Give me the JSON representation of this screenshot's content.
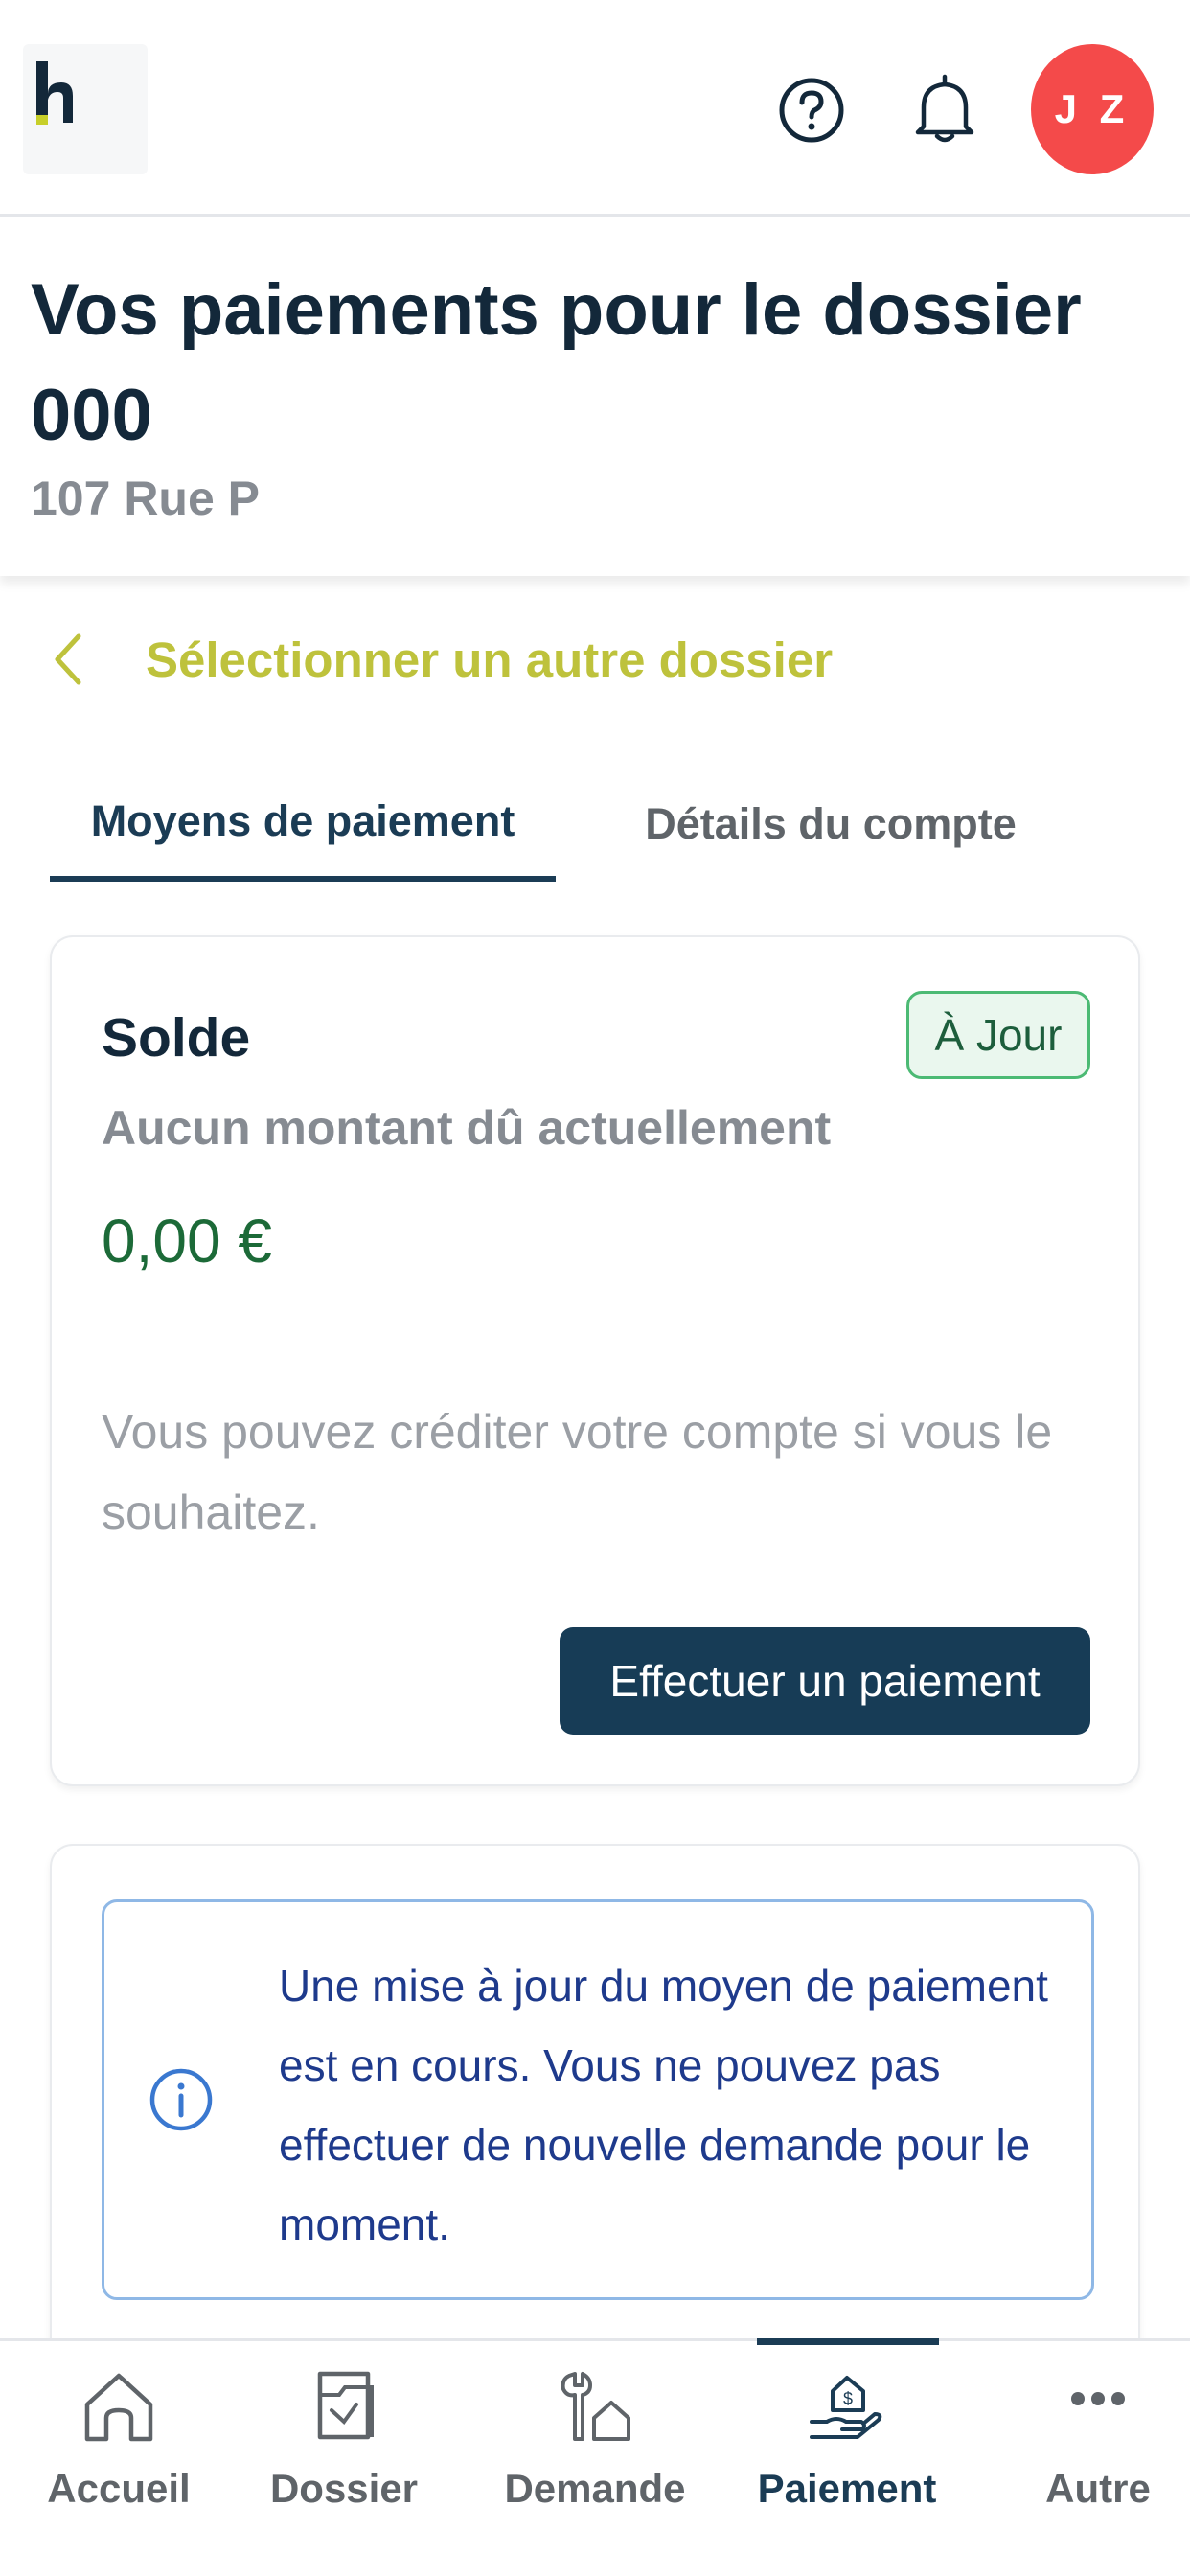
{
  "header": {
    "logo_letter": "h",
    "avatar_initials": "J Z",
    "icons": [
      "help-icon",
      "bell-icon"
    ]
  },
  "page": {
    "title": "Vos paiements pour le dossier 000",
    "subtitle": "107 Rue P"
  },
  "back_link": {
    "label": "Sélectionner un autre dossier",
    "icon": "chevron-left-icon"
  },
  "tabs": [
    {
      "label": "Moyens de paiement",
      "active": true
    },
    {
      "label": "Détails du compte",
      "active": false
    }
  ],
  "balance_card": {
    "title": "Solde",
    "status_badge": "À Jour",
    "due_text": "Aucun montant dû actuellement",
    "amount": "0,00 €",
    "credit_text": "Vous pouvez créditer votre compte si vous le souhaitez.",
    "pay_button": "Effectuer un paiement"
  },
  "info_card": {
    "icon": "info-icon",
    "message": "Une mise à jour du moyen de paiement est en cours. Vous ne pouvez pas effectuer de nouvelle demande pour le moment."
  },
  "bottom_nav": [
    {
      "label": "Accueil",
      "icon": "home-icon",
      "active": false
    },
    {
      "label": "Dossier",
      "icon": "folder-icon",
      "active": false
    },
    {
      "label": "Demande",
      "icon": "wrench-house-icon",
      "active": false
    },
    {
      "label": "Paiement",
      "icon": "payment-hand-icon",
      "active": true
    },
    {
      "label": "Autre",
      "icon": "more-icon",
      "active": false
    }
  ],
  "colors": {
    "primary": "#1b3c55",
    "accent_link": "#bec23c",
    "avatar": "#f44a4a",
    "success": "#1c6a38",
    "info": "#1e3a8c"
  }
}
